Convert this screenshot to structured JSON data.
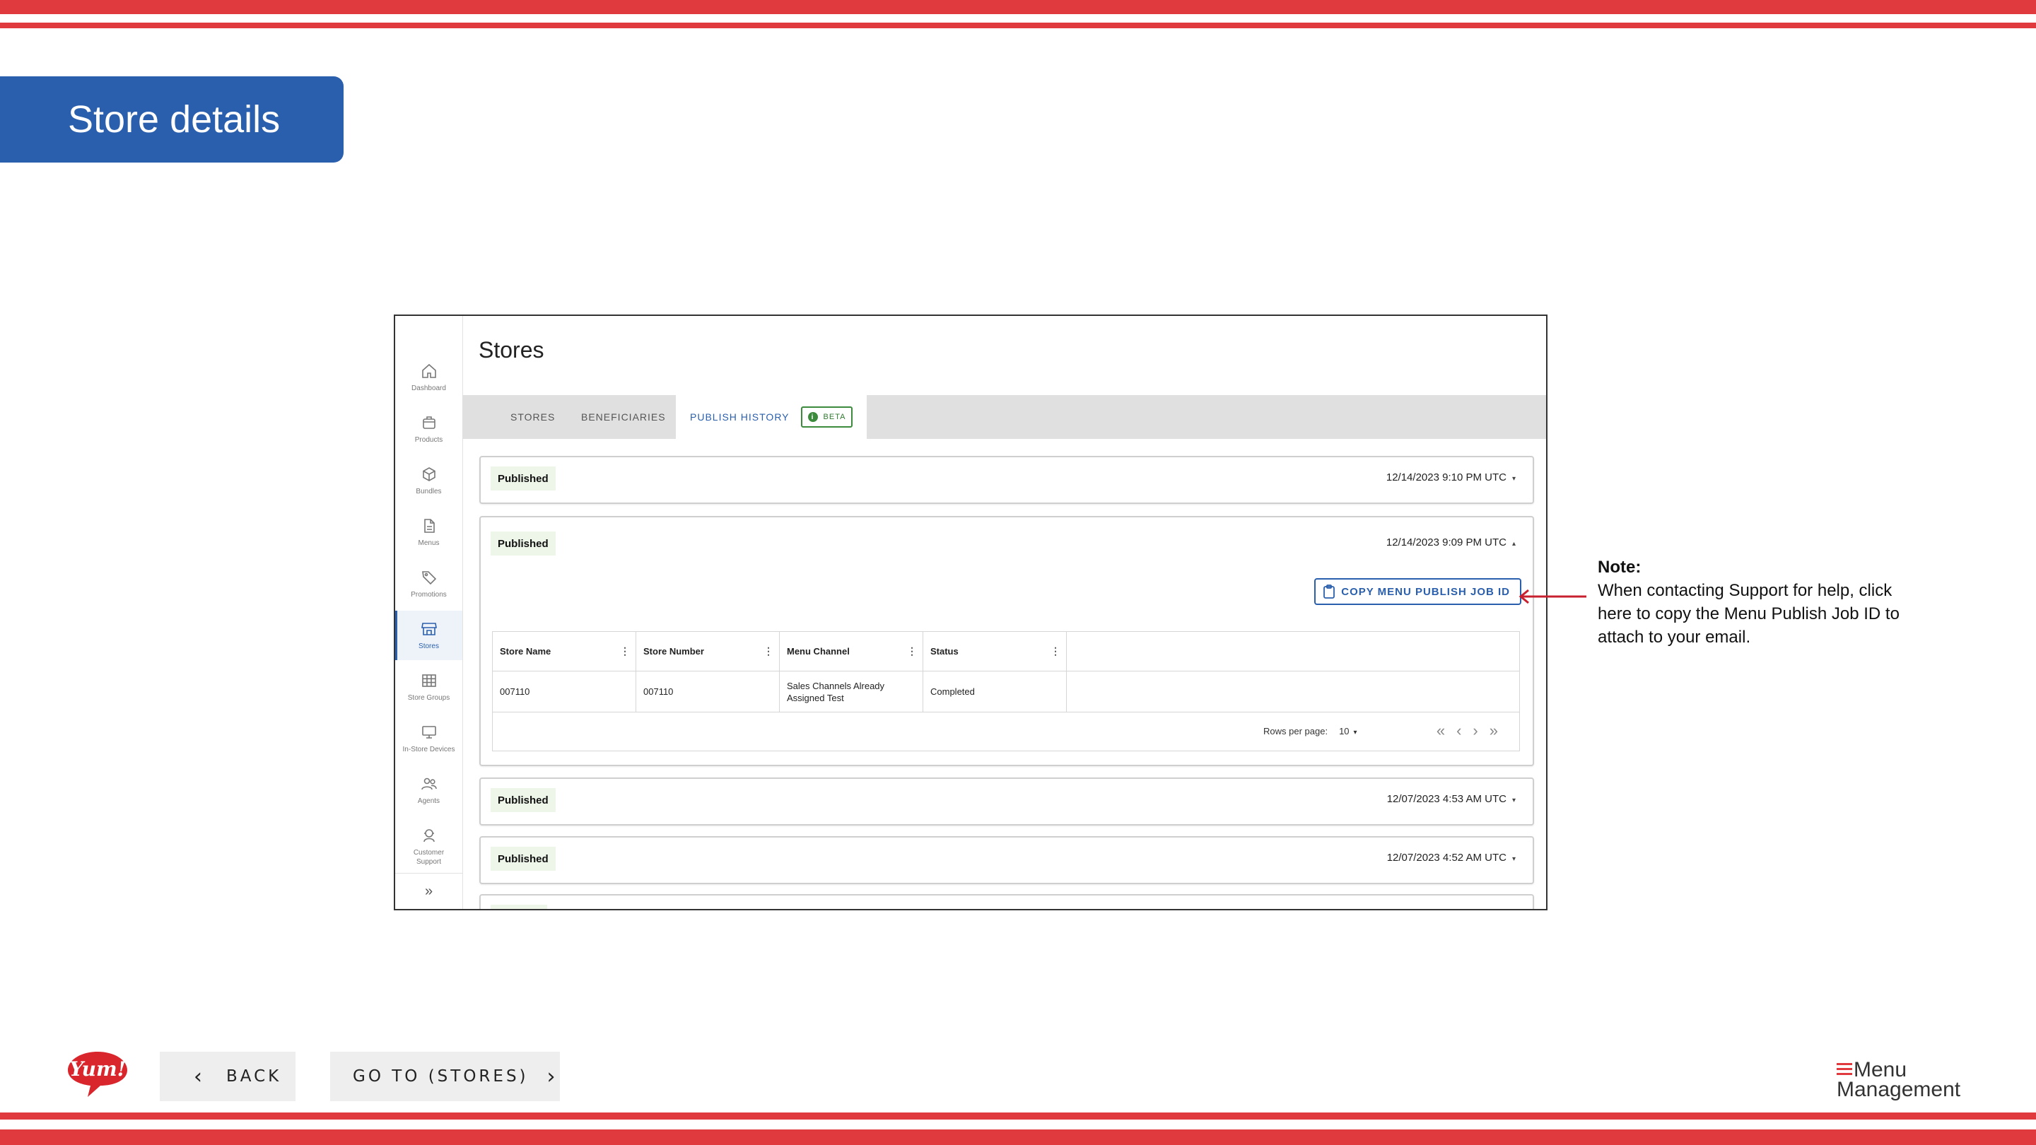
{
  "slide": {
    "title": "Store details",
    "note_title": "Note:",
    "note_body": "When contacting Support for help, click here to copy the Menu Publish Job ID to attach to your email.",
    "back_label": "BACK",
    "goto_label": "GO TO (STORES)",
    "brand_logo": "Yum!",
    "menu_logo_line1": "Menu",
    "menu_logo_line2": "Management",
    "colors": {
      "stripe": "#e03a3e",
      "title_bg": "#2a5fad",
      "accent": "#2a5fad",
      "published_bg": "#eef6ea"
    }
  },
  "app": {
    "page_title": "Stores",
    "sidebar": [
      {
        "label": "Dashboard",
        "icon": "home-icon"
      },
      {
        "label": "Products",
        "icon": "box-icon"
      },
      {
        "label": "Bundles",
        "icon": "cube-icon"
      },
      {
        "label": "Menus",
        "icon": "document-icon"
      },
      {
        "label": "Promotions",
        "icon": "tag-icon"
      },
      {
        "label": "Stores",
        "icon": "storefront-icon",
        "active": true
      },
      {
        "label": "Store Groups",
        "icon": "grid-icon"
      },
      {
        "label": "In-Store Devices",
        "icon": "monitor-icon"
      },
      {
        "label": "Agents",
        "icon": "people-icon"
      },
      {
        "label": "Customer Support",
        "icon": "headset-icon"
      }
    ],
    "tabs": {
      "stores": "STORES",
      "beneficiaries": "BENEFICIARIES",
      "publish_history": "PUBLISH HISTORY",
      "beta": "BETA"
    },
    "entries": [
      {
        "status": "Published",
        "date": "12/14/2023 9:10 PM UTC",
        "caret": "▾"
      },
      {
        "status": "Published",
        "date": "12/14/2023 9:09 PM UTC",
        "caret": "▴"
      },
      {
        "status": "Published",
        "date": "12/07/2023 4:53 AM UTC",
        "caret": "▾"
      },
      {
        "status": "Published",
        "date": "12/07/2023 4:52 AM UTC",
        "caret": "▾"
      }
    ],
    "copy_button": "COPY MENU PUBLISH JOB ID",
    "table": {
      "headers": [
        "Store Name",
        "Store Number",
        "Menu Channel",
        "Status"
      ],
      "rows": [
        [
          "007110",
          "007110",
          "Sales Channels Already Assigned Test",
          "Completed"
        ]
      ],
      "rows_per_page_label": "Rows per page:",
      "rows_per_page_value": "10"
    }
  }
}
